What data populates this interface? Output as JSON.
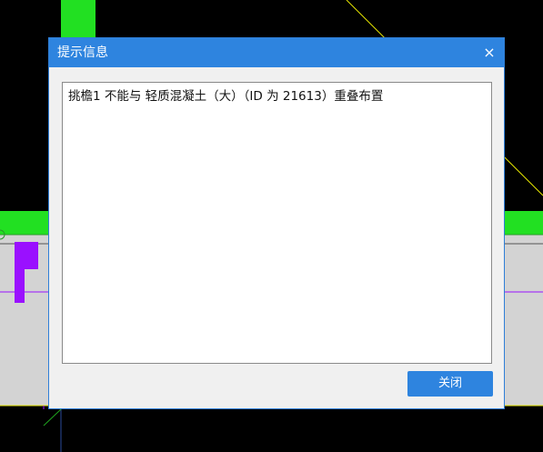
{
  "dialog": {
    "title": "提示信息",
    "close_icon": "×",
    "message": "挑檐1 不能与 轻质混凝土（大）（ID 为 21613）重叠布置",
    "close_button_label": "关闭"
  },
  "colors": {
    "background": "#000000",
    "accent": "#2e84df",
    "green": "#22e022",
    "purple": "#9a10ff",
    "yellow": "#e6e600",
    "gray": "#d3d3d3"
  }
}
